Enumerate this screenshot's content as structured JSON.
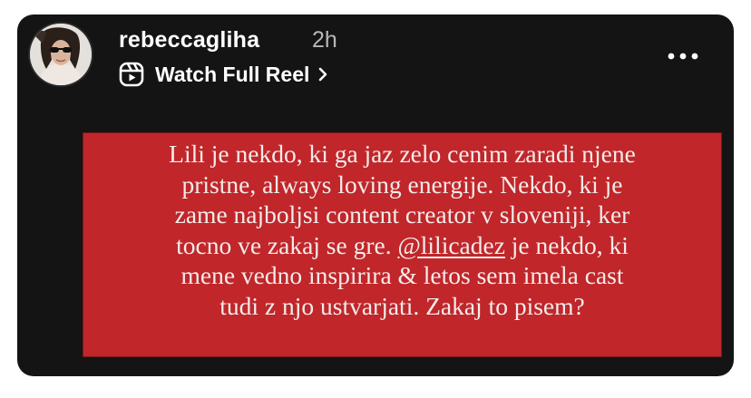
{
  "story": {
    "username": "rebeccagliha",
    "time": "2h",
    "watch_label": "Watch Full Reel"
  },
  "quote": {
    "line1": "Lili je nekdo, ki ga jaz zelo cenim zaradi njene",
    "line2": "pristne, always loving energije. Nekdo, ki je",
    "line3": "zame najboljsi content creator v sloveniji, ker",
    "line4_pre": "tocno ve zakaj se gre. ",
    "line4_mention": "@lilicadez",
    "line4_post": " je nekdo, ki",
    "line5": "mene vedno inspirira & letos sem imela cast",
    "line6": "tudi z njo ustvarjati. Zakaj to pisem?"
  },
  "colors": {
    "card_background": "#141414",
    "quote_background": "#c0262a",
    "quote_text": "#f2ecea",
    "secondary_text": "#b8b8b8"
  },
  "icons": {
    "reel": "reel-icon",
    "chevron": "chevron-right-icon",
    "more": "more-options-icon"
  }
}
